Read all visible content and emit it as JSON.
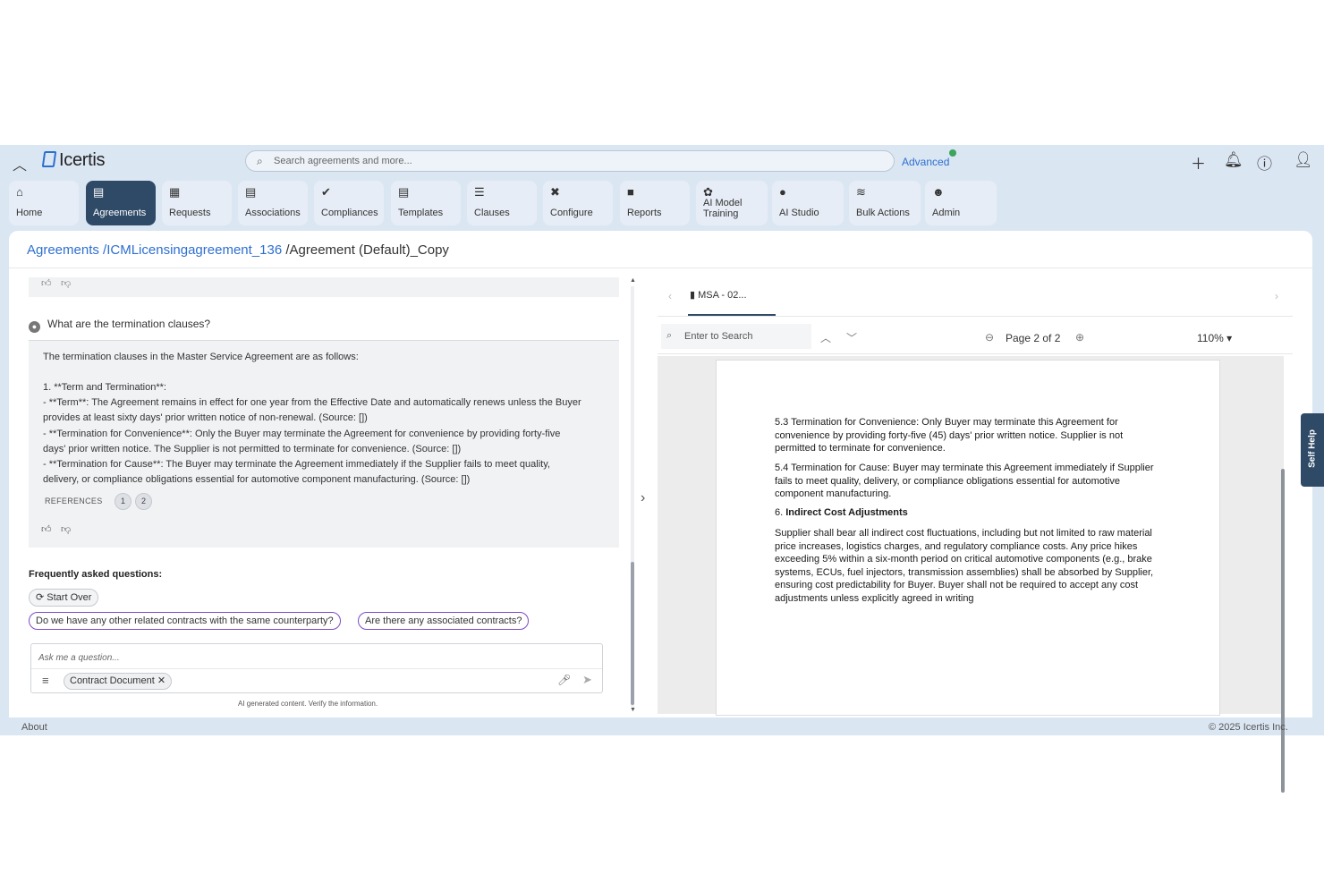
{
  "header": {
    "logo_text": "Icertis",
    "search_placeholder": "Search agreements and more...",
    "advanced_label": "Advanced",
    "icons": [
      "chevron-up-icon",
      "plus-icon",
      "bell-icon",
      "help-icon",
      "user-icon"
    ]
  },
  "nav": [
    {
      "label": "Home",
      "icon": "home-icon",
      "glyph": "⌂"
    },
    {
      "label": "Agreements",
      "icon": "agreement-icon",
      "glyph": "▤",
      "active": true
    },
    {
      "label": "Requests",
      "icon": "request-icon",
      "glyph": "▦"
    },
    {
      "label": "Associations",
      "icon": "association-icon",
      "glyph": "▤"
    },
    {
      "label": "Compliances",
      "icon": "compliance-icon",
      "glyph": "✔"
    },
    {
      "label": "Templates",
      "icon": "template-icon",
      "glyph": "▤"
    },
    {
      "label": "Clauses",
      "icon": "clause-icon",
      "glyph": "☰"
    },
    {
      "label": "Configure",
      "icon": "tools-icon",
      "glyph": "✖"
    },
    {
      "label": "Reports",
      "icon": "report-icon",
      "glyph": "■"
    },
    {
      "label": "AI Model\nTraining",
      "label_line1": "AI Model",
      "label_line2": "Training",
      "icon": "ai-model-icon",
      "glyph": "✿"
    },
    {
      "label": "AI Studio",
      "icon": "lightbulb-icon",
      "glyph": "●"
    },
    {
      "label": "Bulk Actions",
      "icon": "layers-icon",
      "glyph": "≋"
    },
    {
      "label": "Admin",
      "icon": "users-icon",
      "glyph": "☻"
    }
  ],
  "breadcrumb": {
    "root": "Agreements",
    "parent": "/ICMLicensingagreement_136",
    "current": "/Agreement (Default)_Copy"
  },
  "chat": {
    "question": "What are the termination clauses?",
    "answer_lines": [
      "The termination clauses in the Master Service Agreement are as follows:",
      "1. **Term and Termination**:",
      "- **Term**: The Agreement remains in effect for one year from the Effective Date and automatically renews unless the Buyer",
      "provides at least sixty days' prior written notice of non-renewal. (Source: [])",
      "- **Termination for Convenience**: Only the Buyer may terminate the Agreement for convenience by providing forty-five",
      "days' prior written notice. The Supplier is not permitted to terminate for convenience. (Source: [])",
      "- **Termination for Cause**: The Buyer may terminate the Agreement immediately if the Supplier fails to meet quality,",
      "delivery, or compliance obligations essential for automotive component manufacturing. (Source: [])"
    ],
    "references_label": "REFERENCES",
    "references": [
      "1",
      "2"
    ],
    "faq_title": "Frequently asked questions:",
    "start_over": "Start Over",
    "faq_chips": [
      "Do we have any other related contracts with the same counterparty?",
      "Are there any associated contracts?"
    ],
    "ask_placeholder": "Ask me a question...",
    "filter_chip": "Contract Document",
    "disclaimer": "AI generated content. Verify the information."
  },
  "viewer": {
    "tab_label": "MSA - 02...",
    "find_placeholder": "Enter to Search",
    "page_text": "Page 2 of 2",
    "zoom": "110%",
    "paragraphs": [
      "5.3 Termination for Convenience: Only Buyer may terminate this Agreement for convenience by providing forty-five (45) days' prior written notice. Supplier is not permitted to terminate for convenience.",
      "5.4 Termination for Cause: Buyer may terminate this Agreement immediately if Supplier fails to meet quality, delivery, or compliance obligations essential for automotive component manufacturing.",
      "Supplier shall bear all indirect cost fluctuations, including but not limited to raw material price increases, logistics charges, and regulatory compliance costs. Any price hikes exceeding 5% within a six-month period on critical automotive components (e.g., brake systems, ECUs, fuel injectors, transmission assemblies) shall be absorbed by Supplier, ensuring cost predictability for Buyer. Buyer shall not be required to accept any cost adjustments unless explicitly agreed in writing"
    ],
    "heading_num": "6.",
    "heading_text": "Indirect Cost Adjustments"
  },
  "footer": {
    "about": "About",
    "copyright": "© 2025 Icertis Inc."
  },
  "self_help": "Self Help"
}
